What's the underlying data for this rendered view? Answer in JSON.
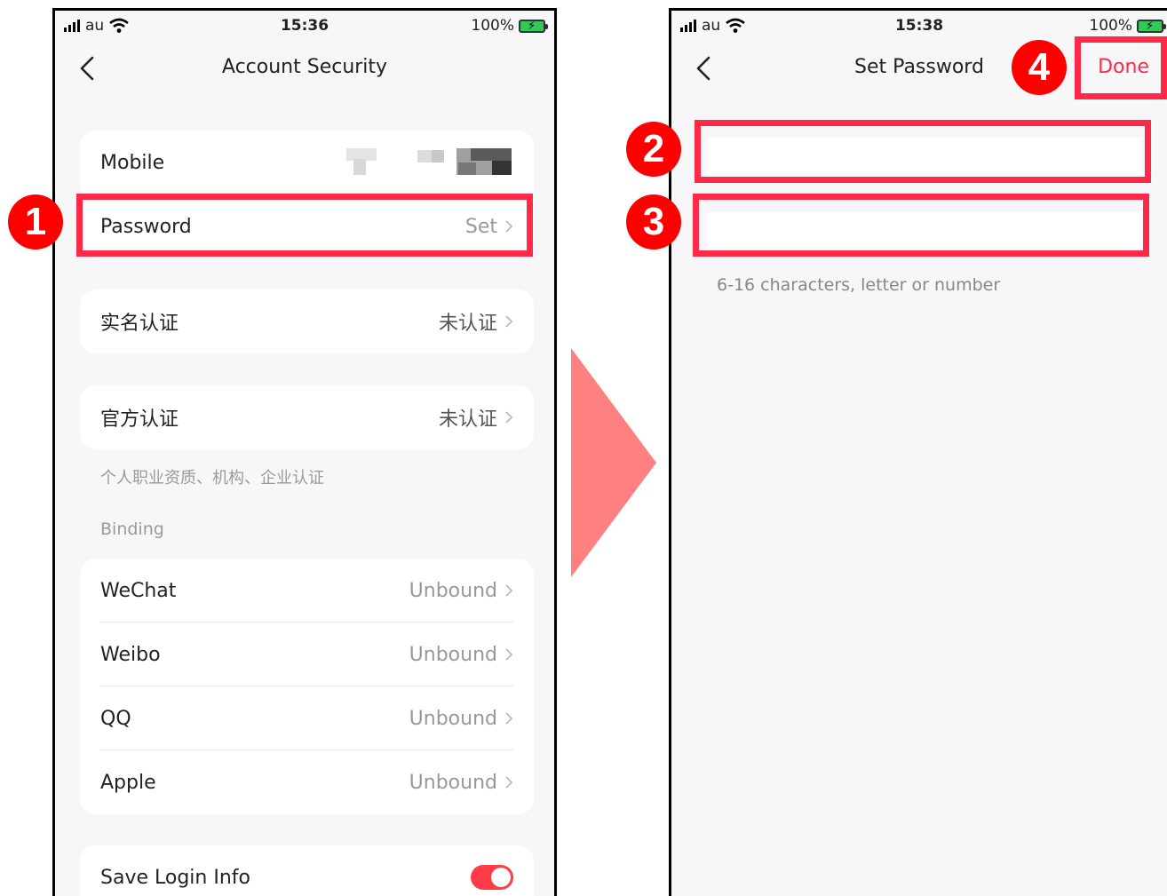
{
  "left": {
    "status": {
      "carrier": "au",
      "time": "15:36",
      "battery": "100%"
    },
    "title": "Account Security",
    "rows": {
      "mobile": "Mobile",
      "password": {
        "label": "Password",
        "value": "Set"
      },
      "realname": {
        "label": "实名认证",
        "value": "未认证"
      },
      "official": {
        "label": "官方认证",
        "value": "未认证"
      }
    },
    "official_note": "个人职业资质、机构、企业认证",
    "binding_header": "Binding",
    "bindings": [
      {
        "label": "WeChat",
        "value": "Unbound"
      },
      {
        "label": "Weibo",
        "value": "Unbound"
      },
      {
        "label": "QQ",
        "value": "Unbound"
      },
      {
        "label": "Apple",
        "value": "Unbound"
      }
    ],
    "save_login": {
      "label": "Save Login Info",
      "enabled": true
    }
  },
  "right": {
    "status": {
      "carrier": "au",
      "time": "15:38",
      "battery": "100%"
    },
    "title": "Set Password",
    "done": "Done",
    "hint": "6-16 characters, letter or number"
  },
  "steps": [
    "1",
    "2",
    "3",
    "4"
  ],
  "colors": {
    "highlight": "#ff2a47",
    "badge": "#ff0000",
    "arrow": "#ff8080",
    "toggle": "#ff3b47"
  }
}
